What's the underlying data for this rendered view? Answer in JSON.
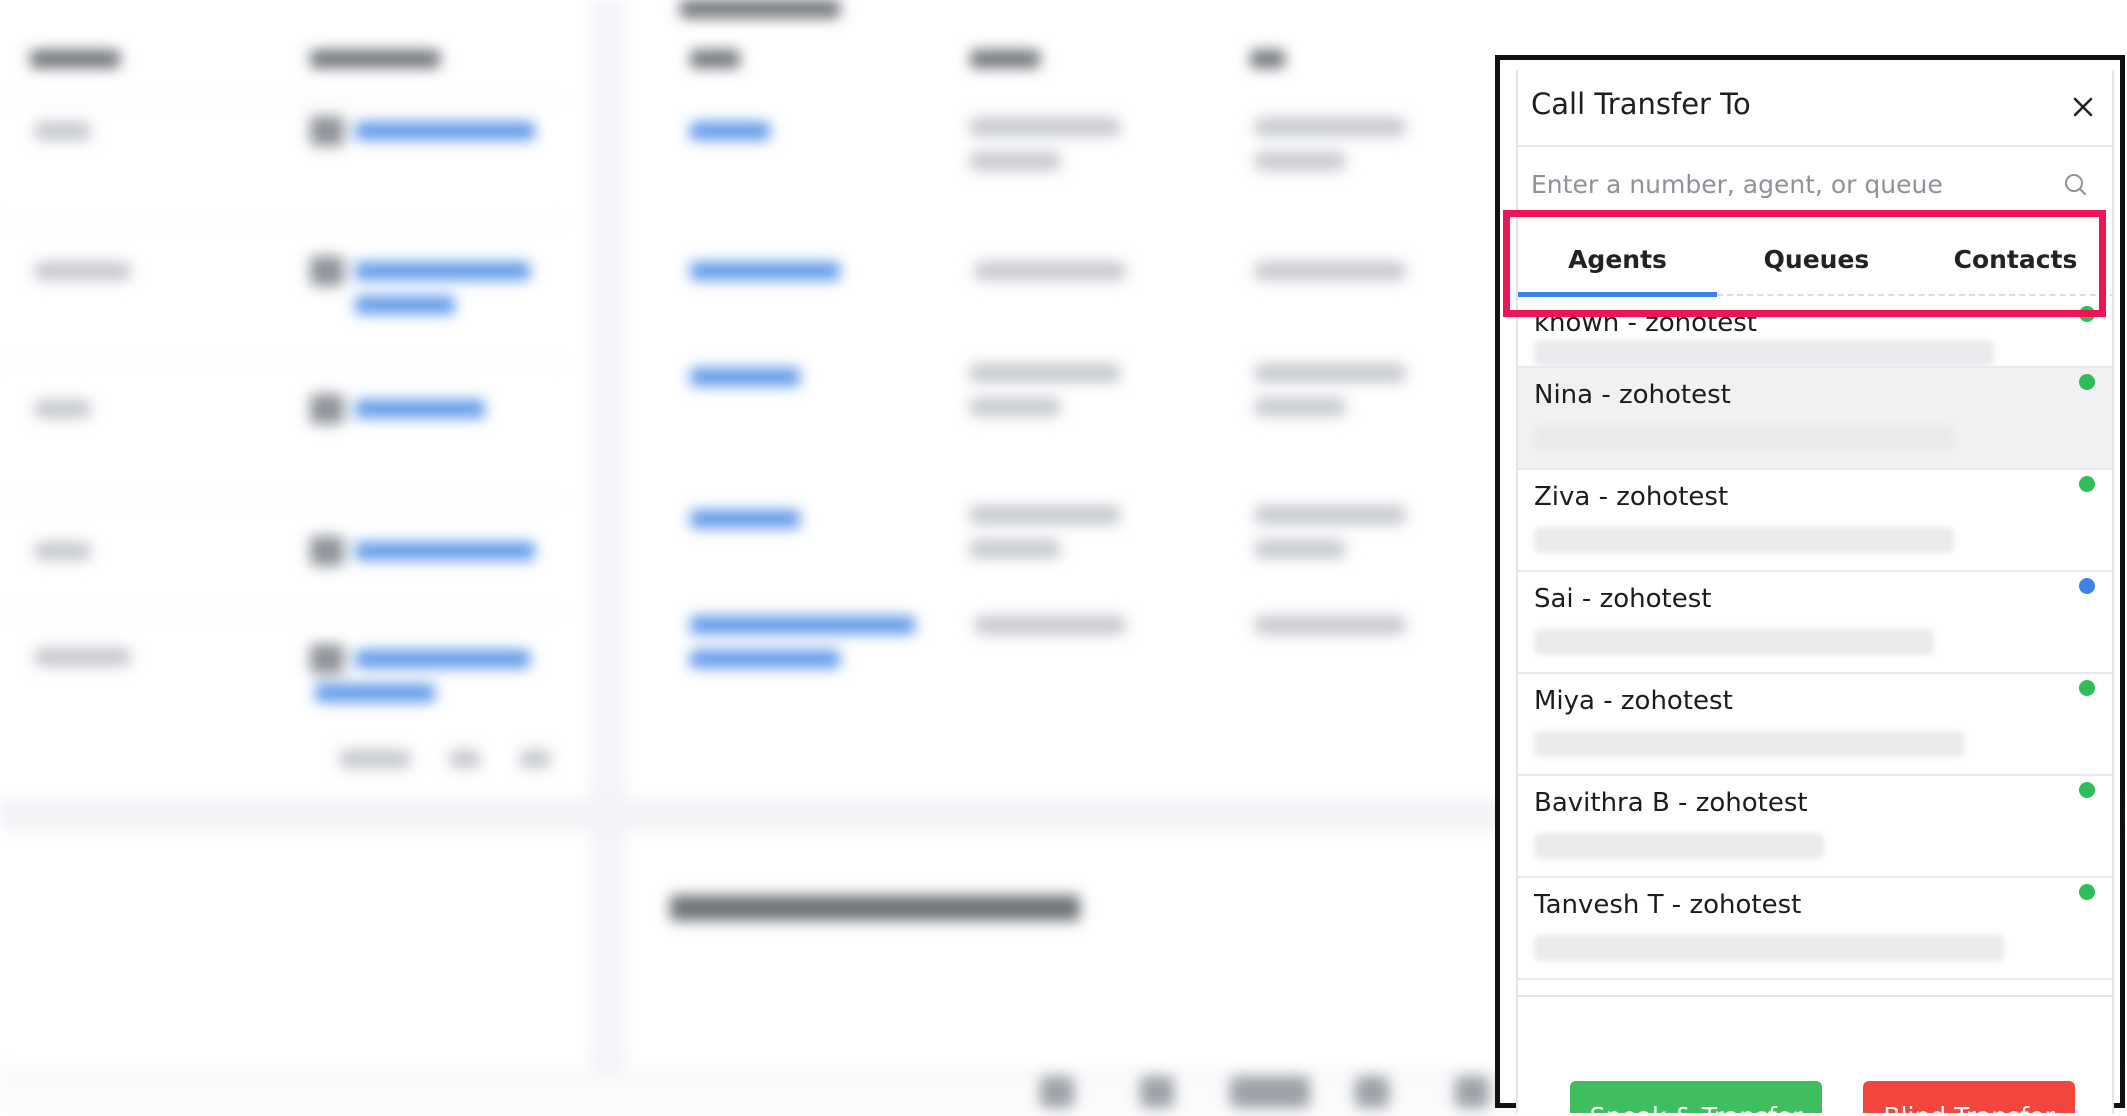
{
  "dialog": {
    "title": "Call Transfer To",
    "close_icon": "close-icon",
    "search": {
      "placeholder": "Enter a number, agent, or queue",
      "value": "",
      "icon": "search-icon"
    },
    "tabs": [
      {
        "label": "Agents",
        "active": true
      },
      {
        "label": "Queues",
        "active": false
      },
      {
        "label": "Contacts",
        "active": false
      }
    ],
    "agents": [
      {
        "name": "known - zohotest",
        "status_color": "#2ebd59"
      },
      {
        "name": "Nina - zohotest",
        "status_color": "#2ebd59"
      },
      {
        "name": "Ziva - zohotest",
        "status_color": "#2ebd59"
      },
      {
        "name": "Sai - zohotest",
        "status_color": "#3d83e6"
      },
      {
        "name": "Miya - zohotest",
        "status_color": "#2ebd59"
      },
      {
        "name": "Bavithra B - zohotest",
        "status_color": "#2ebd59"
      },
      {
        "name": "Tanvesh T - zohotest",
        "status_color": "#2ebd59"
      }
    ],
    "buttons": {
      "speak_transfer": {
        "label": "Speak & Transfer",
        "color": "#3fbe5f"
      },
      "blind_transfer": {
        "label": "Blind Transfer",
        "color": "#f2453d"
      }
    }
  },
  "colors": {
    "highlight": "#ee1556",
    "tab_active": "#3d83e6",
    "frame": "#111111"
  }
}
